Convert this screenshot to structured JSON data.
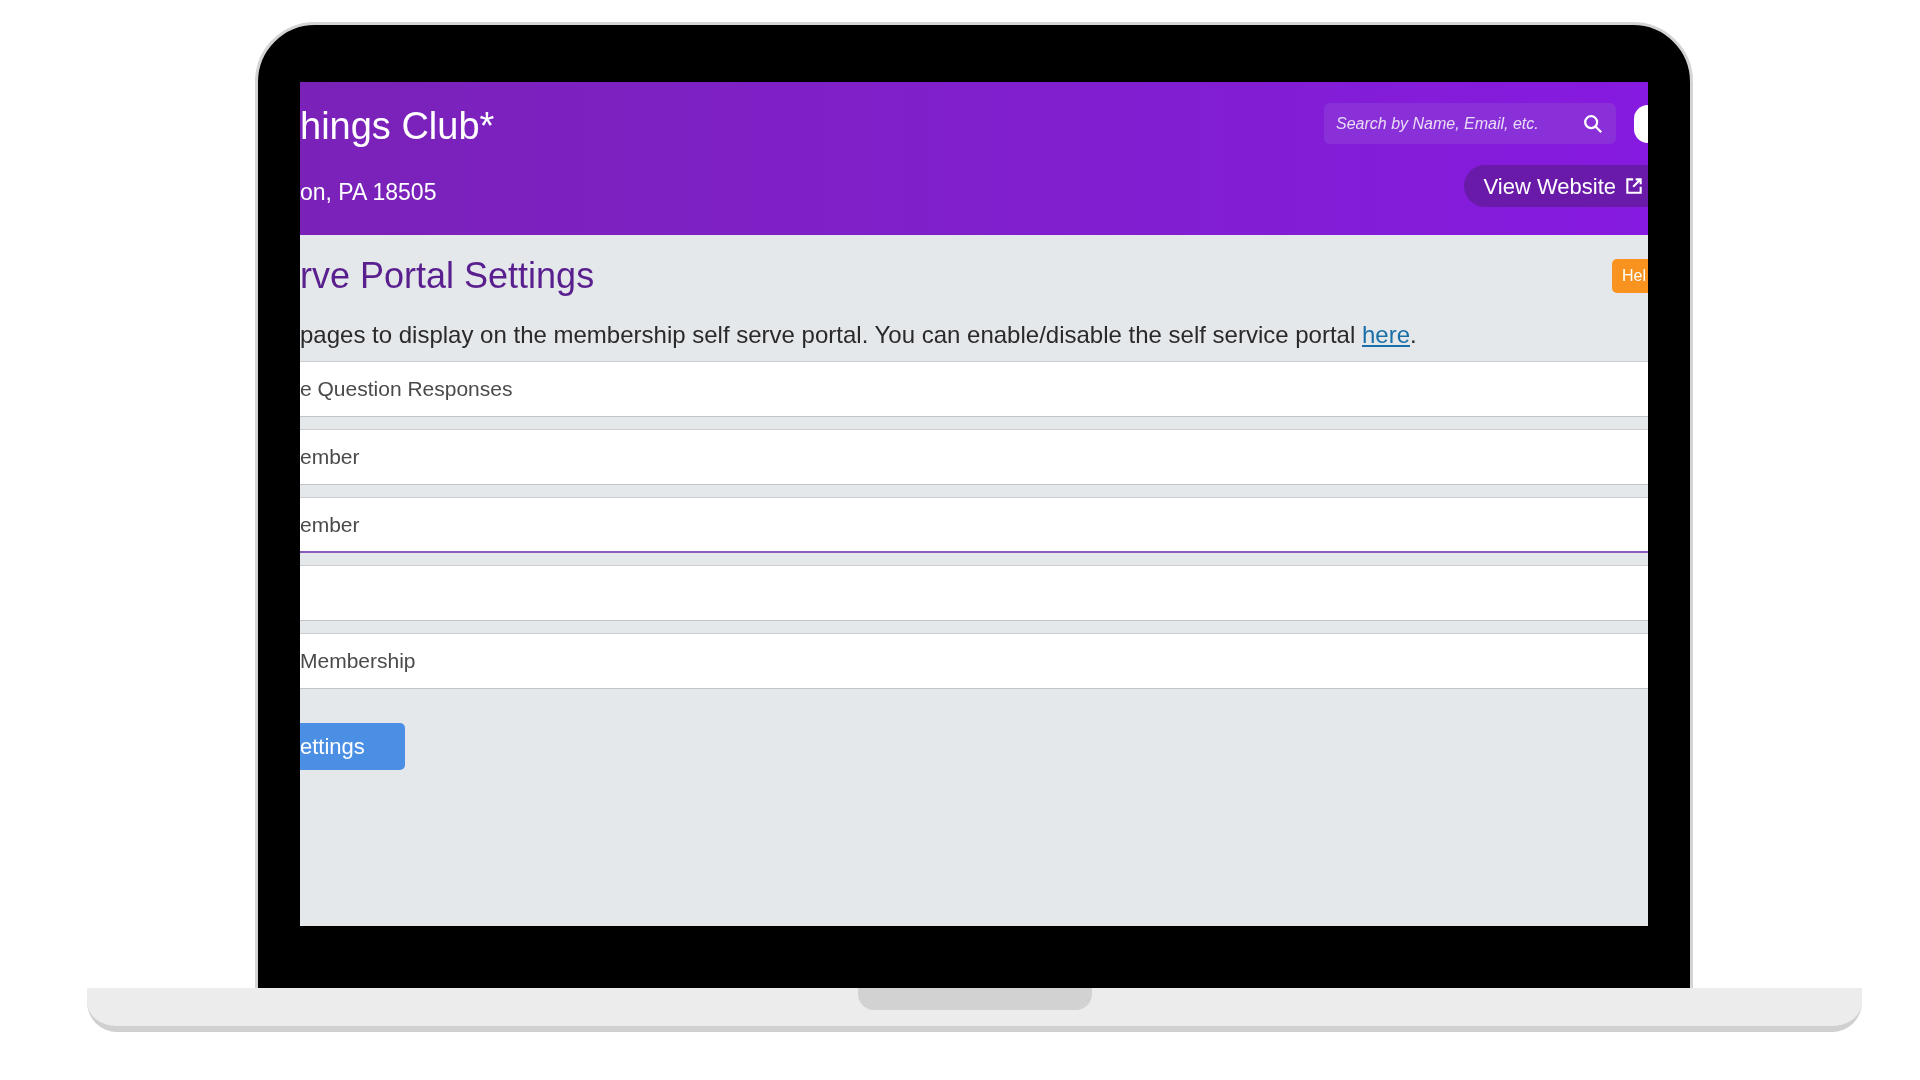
{
  "header": {
    "title": "hings Club*",
    "address": "on, PA 18505",
    "search": {
      "placeholder": "Search by Name, Email, etc."
    },
    "view_website": "View Website"
  },
  "page": {
    "heading": "rve Portal Settings",
    "help": "Hel",
    "description": "pages to display on the membership self serve portal. You can enable/disable the self service portal ",
    "link": "here",
    "after_link": "."
  },
  "rows": [
    {
      "label": "e Question Responses",
      "highlighted": false
    },
    {
      "label": "ember",
      "highlighted": false
    },
    {
      "label": "ember",
      "highlighted": true
    },
    {
      "label": "",
      "highlighted": false
    },
    {
      "label": "Membership",
      "highlighted": false
    }
  ],
  "save_button": "ettings"
}
